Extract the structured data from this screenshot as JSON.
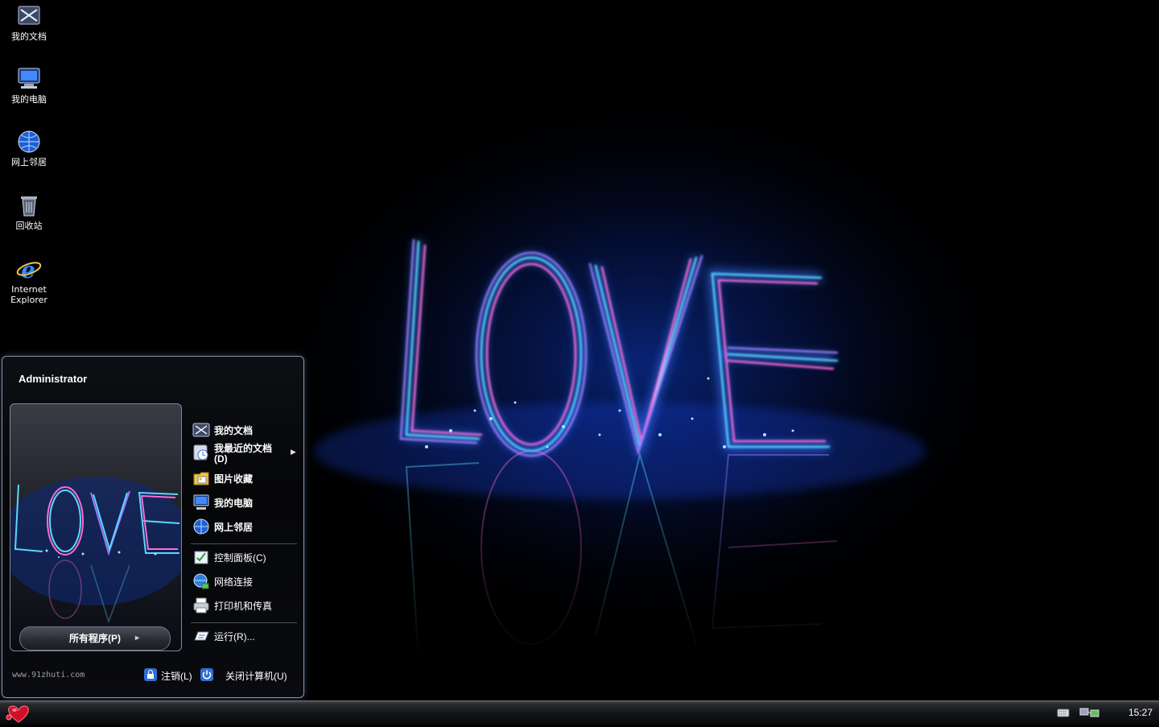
{
  "desktop": {
    "icons": [
      {
        "label": "我的文档",
        "icon": "my-documents-icon"
      },
      {
        "label": "我的电脑",
        "icon": "my-computer-icon"
      },
      {
        "label": "网上邻居",
        "icon": "network-places-icon"
      },
      {
        "label": "回收站",
        "icon": "recycle-bin-icon"
      },
      {
        "label_line1": "Internet",
        "label_line2": "Explorer",
        "icon": "internet-explorer-icon"
      }
    ],
    "wallpaper_text": "LOVE"
  },
  "start_menu": {
    "user": "Administrator",
    "user_picture_text": "LOVE",
    "all_programs": "所有程序(P)",
    "items_primary": [
      {
        "label": "我的文档",
        "icon": "my-documents-icon"
      },
      {
        "label_line1": "我最近的文档",
        "label_line2": "(D)",
        "icon": "recent-documents-icon",
        "has_submenu": true
      },
      {
        "label": "图片收藏",
        "icon": "my-pictures-icon"
      },
      {
        "label": "我的电脑",
        "icon": "my-computer-icon"
      },
      {
        "label": "网上邻居",
        "icon": "network-places-icon"
      }
    ],
    "items_secondary": [
      {
        "label": "控制面板(C)",
        "icon": "control-panel-icon"
      },
      {
        "label": "网络连接",
        "icon": "network-connections-icon"
      },
      {
        "label": "打印机和传真",
        "icon": "printers-faxes-icon"
      }
    ],
    "run": {
      "label": "运行(R)...",
      "icon": "run-icon"
    },
    "footer": {
      "url": "www.91zhuti.com",
      "logoff": "注销(L)",
      "shutdown": "关闭计算机(U)"
    }
  },
  "taskbar": {
    "start_icon": "heart-start-icon",
    "tray_icons": [
      "keyboard-icon",
      "network-tray-icon"
    ],
    "clock": "15:27"
  },
  "colors": {
    "neon_blue": "#3a7bff",
    "neon_magenta": "#ff4fd8",
    "neon_cyan": "#4ff3ff",
    "start_red": "#d0102a"
  }
}
